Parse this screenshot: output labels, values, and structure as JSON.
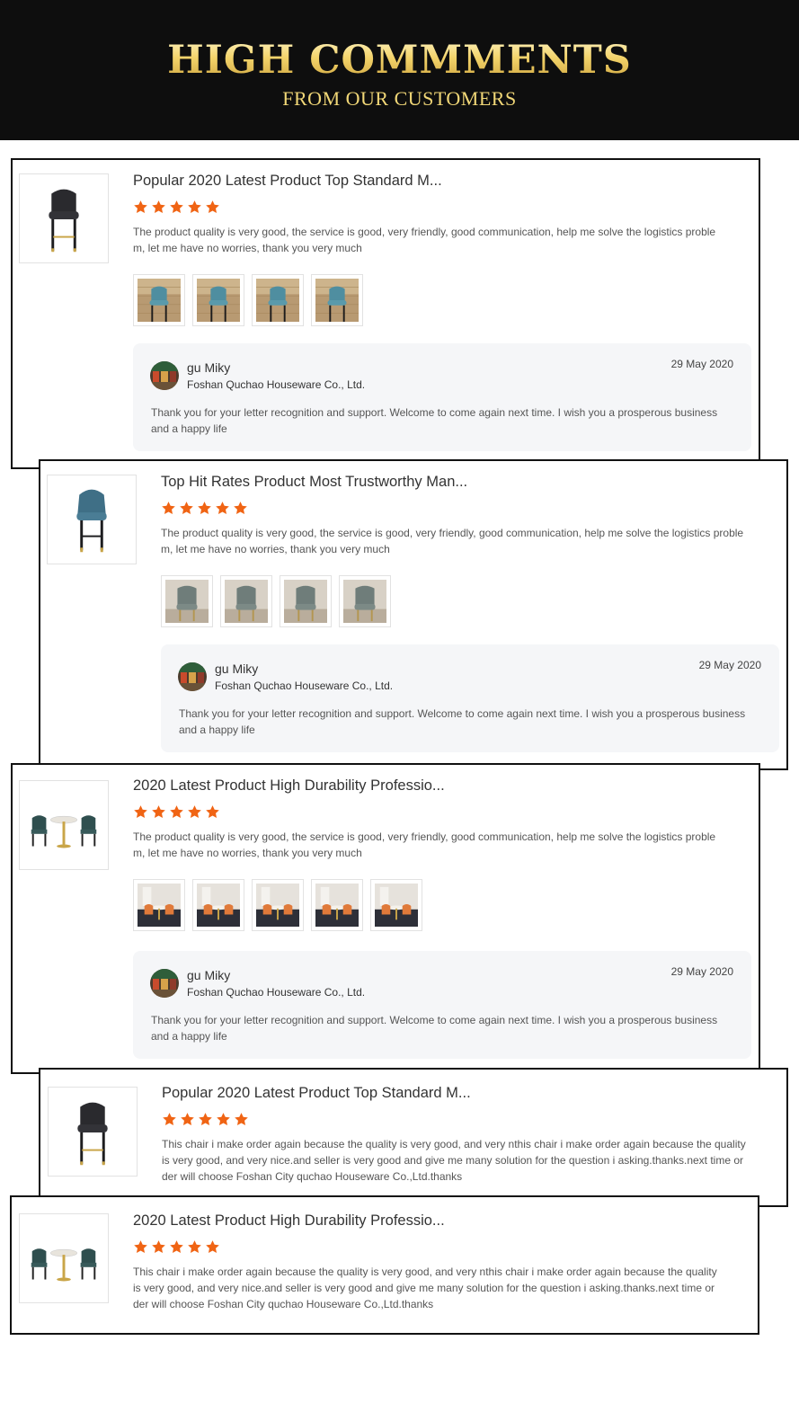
{
  "header": {
    "title": "HIGH COMMMENTS",
    "subtitle": "FROM OUR CUSTOMERS"
  },
  "colors": {
    "banner_bg": "#0e0e0e",
    "banner_gold": "#f1d777",
    "star": "#f06414",
    "reply_bg": "#f5f6f8"
  },
  "reviews": [
    {
      "product_title": "Popular 2020 Latest Product Top Standard M...",
      "product_icon": "bar-stool-icon",
      "rating": 5,
      "comment": "The product quality is very good, the service is good, very friendly, good communication, help me solve the logistics proble m, let me have no worries, thank you very much",
      "photos": [
        "photo-stool-1",
        "photo-stool-2",
        "photo-stool-3",
        "photo-stool-4"
      ],
      "reply": {
        "name": "gu Miky",
        "company": "Foshan Quchao Houseware Co., Ltd.",
        "date": "29 May 2020",
        "text": "Thank you for your letter recognition and support. Welcome to come again next time. I wish you a prosperous business and a happy life"
      }
    },
    {
      "product_title": "Top Hit Rates Product Most Trustworthy Man...",
      "product_icon": "blue-bar-stool-icon",
      "rating": 5,
      "comment": "The product quality is very good, the service is good, very friendly, good communication, help me solve the logistics proble m, let me have no worries, thank you very much",
      "photos": [
        "photo-chair-1",
        "photo-chair-2",
        "photo-chair-3",
        "photo-chair-4"
      ],
      "reply": {
        "name": "gu Miky",
        "company": "Foshan Quchao Houseware Co., Ltd.",
        "date": "29 May 2020",
        "text": "Thank you for your letter recognition and support. Welcome to come again next time. I wish you a prosperous business and a happy life"
      }
    },
    {
      "product_title": "2020 Latest Product High Durability Professio...",
      "product_icon": "table-set-icon",
      "rating": 5,
      "comment": "The product quality is very good, the service is good, very friendly, good communication, help me solve the logistics proble m, let me have no worries, thank you very much",
      "photos": [
        "photo-room-1",
        "photo-room-2",
        "photo-room-3",
        "photo-room-4",
        "photo-room-5"
      ],
      "reply": {
        "name": "gu Miky",
        "company": "Foshan Quchao Houseware Co., Ltd.",
        "date": "29 May 2020",
        "text": "Thank you for your letter recognition and support. Welcome to come again next time. I wish you a prosperous business and a happy life"
      }
    },
    {
      "product_title": "Popular 2020 Latest Product Top Standard M...",
      "product_icon": "bar-stool-icon",
      "rating": 5,
      "comment": "This chair i make order again because the quality is very good, and very nthis chair i make order again because the quality is very good, and very nice.and seller is very good and give me many solution for the question i asking.thanks.next time or der will choose Foshan City quchao Houseware Co.,Ltd.thanks"
    },
    {
      "product_title": "2020 Latest Product High Durability Professio...",
      "product_icon": "table-set-icon",
      "rating": 5,
      "comment": "This chair i make order again because the quality is very good, and very nthis chair i make order again because the quality is very good, and very nice.and seller is very good and give me many solution for the question i asking.thanks.next time or der will choose Foshan City quchao Houseware Co.,Ltd.thanks"
    }
  ]
}
